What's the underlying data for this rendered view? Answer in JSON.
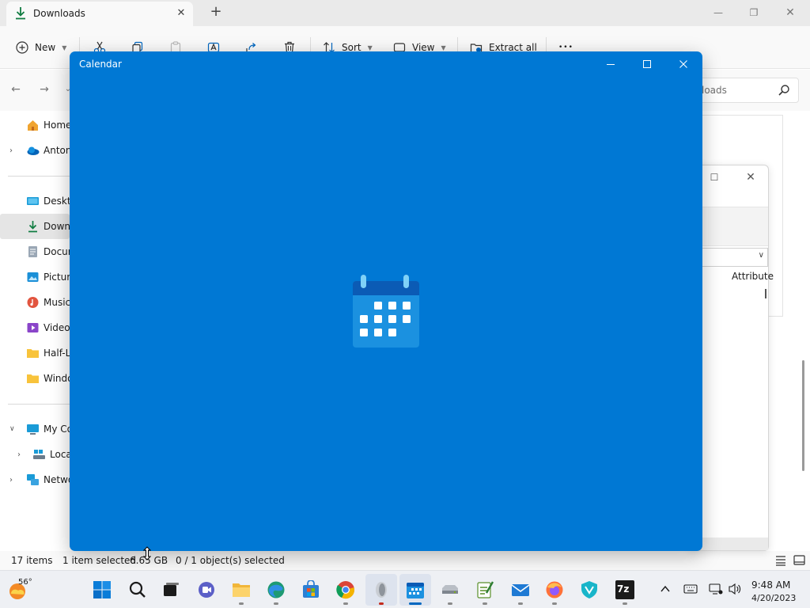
{
  "explorer": {
    "tab_title": "Downloads",
    "toolbar": {
      "new_label": "New",
      "sort_label": "Sort",
      "view_label": "View",
      "extract_label": "Extract all",
      "more_label": "•••"
    },
    "search_placeholder": "loads",
    "nav_items": [
      {
        "label": "Home"
      },
      {
        "label": "Anton"
      },
      {
        "label": "Deskto"
      },
      {
        "label": "Downl"
      },
      {
        "label": "Docur"
      },
      {
        "label": "Pictur"
      },
      {
        "label": "Music"
      },
      {
        "label": "Videos"
      },
      {
        "label": "Half-L"
      },
      {
        "label": "Windo"
      },
      {
        "label": "My Co"
      },
      {
        "label": "Loca"
      },
      {
        "label": "Netwo"
      }
    ],
    "status": {
      "item_count": "17 items",
      "selected": "1 item selected",
      "size": "6.65 GB",
      "objects": "0 / 1 object(s) selected"
    }
  },
  "properties_window": {
    "column_header": "Attribute"
  },
  "calendar": {
    "title": "Calendar",
    "accent": "#0078d4"
  },
  "taskbar": {
    "weather_temp": "56°",
    "apps": [
      "start-icon",
      "search-icon",
      "task-view-icon",
      "teams-icon",
      "file-explorer-icon",
      "edge-icon",
      "store-icon",
      "chrome-icon",
      "app-icon",
      "calendar-icon",
      "drive-icon",
      "notepad-icon",
      "mail-icon",
      "firefox-icon",
      "vpn-icon",
      "7zip-icon"
    ],
    "seven_zip_label": "7z",
    "time": "9:48 AM",
    "date": "4/20/2023"
  }
}
